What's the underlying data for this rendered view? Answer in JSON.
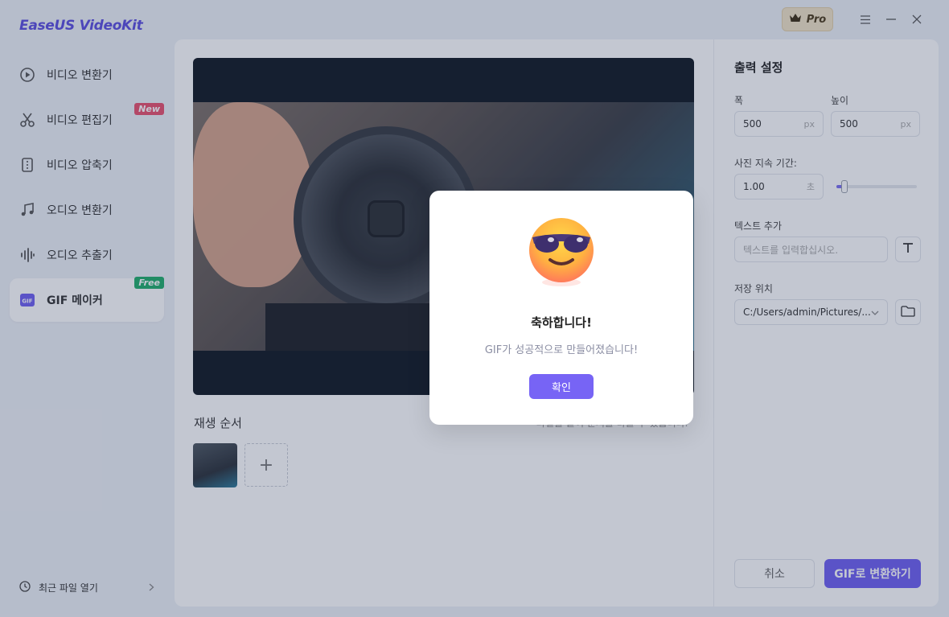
{
  "app": {
    "title": "EaseUS VideoKit",
    "pro_label": "Pro"
  },
  "sidebar": {
    "items": [
      {
        "label": "비디오 변환기",
        "icon": "video-convert-icon"
      },
      {
        "label": "비디오 편집기",
        "icon": "scissors-icon",
        "badge": "New"
      },
      {
        "label": "비디오 압축기",
        "icon": "compress-icon"
      },
      {
        "label": "오디오 변환기",
        "icon": "music-note-icon"
      },
      {
        "label": "오디오 추출기",
        "icon": "waveform-icon"
      },
      {
        "label": "GIF 메이커",
        "icon": "gif-icon",
        "badge": "Free",
        "active": true
      }
    ],
    "recent_label": "최근 파일 열기"
  },
  "main": {
    "playlist_title": "재생 순서",
    "hint": "파일을 끌어 순서를 바꿀 수 있습니다.",
    "add_symbol": "+"
  },
  "settings": {
    "title": "출력 설정",
    "width_label": "폭",
    "width_value": "500",
    "width_unit": "px",
    "height_label": "높이",
    "height_value": "500",
    "height_unit": "px",
    "duration_label": "사진 지속 기간:",
    "duration_value": "1.00",
    "duration_unit": "초",
    "duration_slider": 0.1,
    "text_label": "텍스트 추가",
    "text_placeholder": "텍스트를 입력합십시오.",
    "save_label": "저장 위치",
    "save_path": "C:/Users/admin/Pictures/...",
    "cancel_label": "취소",
    "convert_label": "GIF로 변환하기"
  },
  "dialog": {
    "title": "축하합니다!",
    "message": "GIF가 성공적으로 만들어졌습니다!",
    "confirm_label": "확인"
  },
  "colors": {
    "accent": "#6e5ff2",
    "new_badge": "#e94f6d",
    "free_badge": "#1fae6a",
    "logo": "#5b4de0"
  }
}
